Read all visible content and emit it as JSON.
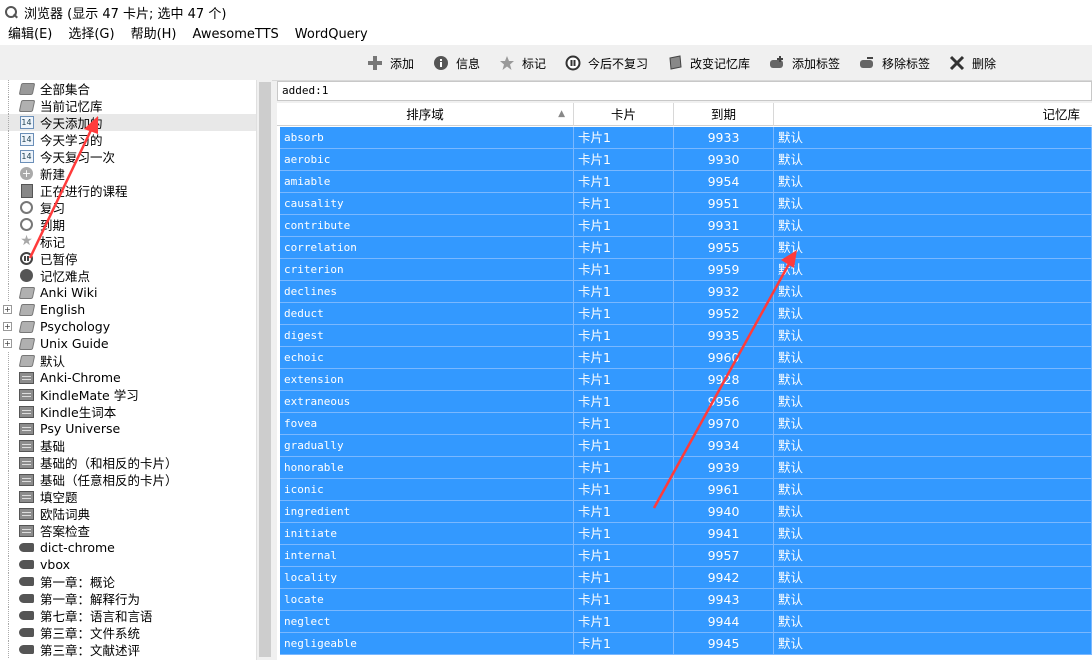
{
  "window": {
    "title": "浏览器 (显示 47 卡片; 选中 47 个)"
  },
  "menu": [
    "编辑(E)",
    "选择(G)",
    "帮助(H)",
    "AwesomeTTS",
    "WordQuery"
  ],
  "toolbar": {
    "add": "添加",
    "info": "信息",
    "mark": "标记",
    "suspend": "今后不复习",
    "change_deck": "改变记忆库",
    "add_tags": "添加标签",
    "remove_tags": "移除标签",
    "delete": "删除"
  },
  "sidebar": {
    "items": [
      {
        "label": "全部集合",
        "icon": "collection-icon"
      },
      {
        "label": "当前记忆库",
        "icon": "deck-icon"
      },
      {
        "label": "今天添加的",
        "icon": "calendar-icon",
        "cal": "14"
      },
      {
        "label": "今天学习的",
        "icon": "calendar-icon",
        "cal": "14"
      },
      {
        "label": "今天复习一次",
        "icon": "calendar-icon",
        "cal": "14"
      },
      {
        "label": "新建",
        "icon": "new-icon"
      },
      {
        "label": "正在进行的课程",
        "icon": "book-icon"
      },
      {
        "label": "复习",
        "icon": "clock-icon"
      },
      {
        "label": "到期",
        "icon": "clock-icon"
      },
      {
        "label": "标记",
        "icon": "star-icon"
      },
      {
        "label": "已暂停",
        "icon": "pause-icon"
      },
      {
        "label": "记忆难点",
        "icon": "bomb-icon"
      },
      {
        "label": "Anki Wiki",
        "icon": "deck-icon"
      },
      {
        "label": "English",
        "icon": "deck-icon",
        "expand": "+"
      },
      {
        "label": "Psychology",
        "icon": "deck-icon",
        "expand": "+"
      },
      {
        "label": "Unix Guide",
        "icon": "deck-icon",
        "expand": "+"
      },
      {
        "label": "默认",
        "icon": "deck-icon"
      },
      {
        "label": "Anki-Chrome",
        "icon": "note-type-icon"
      },
      {
        "label": "KindleMate 学习",
        "icon": "note-type-icon"
      },
      {
        "label": "Kindle生词本",
        "icon": "note-type-icon"
      },
      {
        "label": "Psy Universe",
        "icon": "note-type-icon"
      },
      {
        "label": "基础",
        "icon": "note-type-icon"
      },
      {
        "label": "基础的（和相反的卡片）",
        "icon": "note-type-icon"
      },
      {
        "label": "基础（任意相反的卡片）",
        "icon": "note-type-icon"
      },
      {
        "label": "填空题",
        "icon": "note-type-icon"
      },
      {
        "label": "欧陆词典",
        "icon": "note-type-icon"
      },
      {
        "label": "答案检查",
        "icon": "note-type-icon"
      },
      {
        "label": "dict-chrome",
        "icon": "tag-icon"
      },
      {
        "label": "vbox",
        "icon": "tag-icon"
      },
      {
        "label": "第一章：概论",
        "icon": "tag-icon"
      },
      {
        "label": "第一章：解释行为",
        "icon": "tag-icon"
      },
      {
        "label": "第七章：语言和言语",
        "icon": "tag-icon"
      },
      {
        "label": "第三章：文件系统",
        "icon": "tag-icon"
      },
      {
        "label": "第三章：文献述评",
        "icon": "tag-icon"
      }
    ]
  },
  "search": {
    "value": "added:1"
  },
  "table": {
    "headers": {
      "sort_field": "排序域",
      "card": "卡片",
      "due": "到期",
      "deck": "记忆库"
    },
    "rows": [
      [
        "absorb",
        "卡片1",
        "9933",
        "默认"
      ],
      [
        "aerobic",
        "卡片1",
        "9930",
        "默认"
      ],
      [
        "amiable",
        "卡片1",
        "9954",
        "默认"
      ],
      [
        "causality",
        "卡片1",
        "9951",
        "默认"
      ],
      [
        "contribute",
        "卡片1",
        "9931",
        "默认"
      ],
      [
        "correlation",
        "卡片1",
        "9955",
        "默认"
      ],
      [
        "criterion",
        "卡片1",
        "9959",
        "默认"
      ],
      [
        "declines",
        "卡片1",
        "9932",
        "默认"
      ],
      [
        "deduct",
        "卡片1",
        "9952",
        "默认"
      ],
      [
        "digest",
        "卡片1",
        "9935",
        "默认"
      ],
      [
        "echoic",
        "卡片1",
        "9960",
        "默认"
      ],
      [
        "extension",
        "卡片1",
        "9928",
        "默认"
      ],
      [
        "extraneous",
        "卡片1",
        "9956",
        "默认"
      ],
      [
        "fovea",
        "卡片1",
        "9970",
        "默认"
      ],
      [
        "gradually",
        "卡片1",
        "9934",
        "默认"
      ],
      [
        "honorable",
        "卡片1",
        "9939",
        "默认"
      ],
      [
        "iconic",
        "卡片1",
        "9961",
        "默认"
      ],
      [
        "ingredient",
        "卡片1",
        "9940",
        "默认"
      ],
      [
        "initiate",
        "卡片1",
        "9941",
        "默认"
      ],
      [
        "internal",
        "卡片1",
        "9957",
        "默认"
      ],
      [
        "locality",
        "卡片1",
        "9942",
        "默认"
      ],
      [
        "locate",
        "卡片1",
        "9943",
        "默认"
      ],
      [
        "neglect",
        "卡片1",
        "9944",
        "默认"
      ],
      [
        "negligeable",
        "卡片1",
        "9945",
        "默认"
      ]
    ]
  },
  "colors": {
    "selection": "#3399ff",
    "annotation_arrow": "#ff3b3b"
  }
}
